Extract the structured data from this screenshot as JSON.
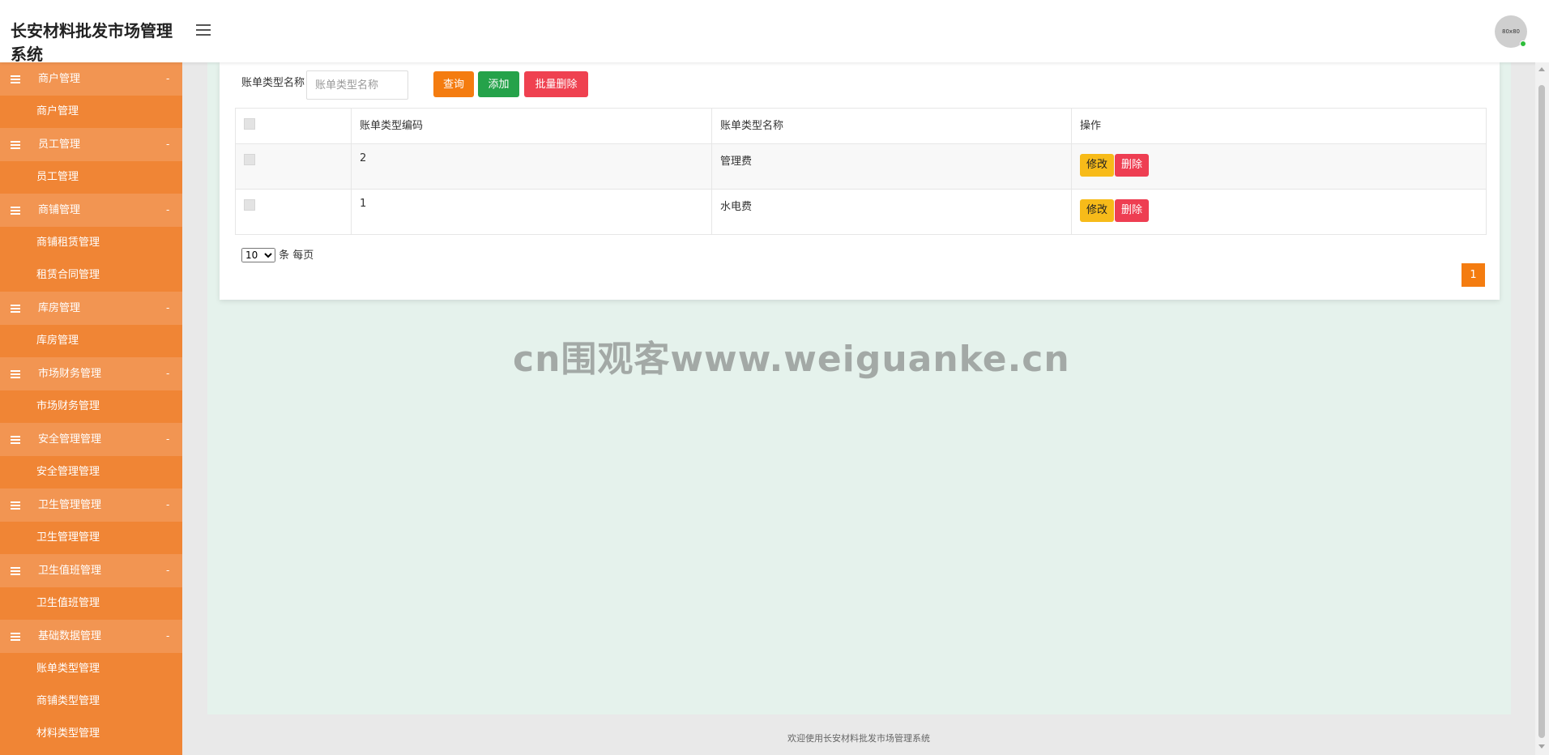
{
  "app": {
    "title": "长安材料批发市场管理系统",
    "avatar_text": "80x80"
  },
  "sidebar": {
    "groups": [
      {
        "label": "商户管理",
        "caret": "-",
        "items": [
          "商户管理"
        ]
      },
      {
        "label": "员工管理",
        "caret": "-",
        "items": [
          "员工管理"
        ]
      },
      {
        "label": "商铺管理",
        "caret": "-",
        "items": [
          "商铺租赁管理",
          "租赁合同管理"
        ]
      },
      {
        "label": "库房管理",
        "caret": "-",
        "items": [
          "库房管理"
        ]
      },
      {
        "label": "市场财务管理",
        "caret": "-",
        "items": [
          "市场财务管理"
        ]
      },
      {
        "label": "安全管理管理",
        "caret": "-",
        "items": [
          "安全管理管理"
        ]
      },
      {
        "label": "卫生管理管理",
        "caret": "-",
        "items": [
          "卫生管理管理"
        ]
      },
      {
        "label": "卫生值班管理",
        "caret": "-",
        "items": [
          "卫生值班管理"
        ]
      },
      {
        "label": "基础数据管理",
        "caret": "-",
        "items": [
          "账单类型管理",
          "商铺类型管理",
          "材料类型管理"
        ]
      }
    ]
  },
  "search": {
    "label": "账单类型名称",
    "placeholder": "账单类型名称",
    "value": ""
  },
  "toolbar": {
    "query_label": "查询",
    "add_label": "添加",
    "batch_delete_label": "批量删除"
  },
  "table": {
    "headers": {
      "code": "账单类型编码",
      "name": "账单类型名称",
      "actions": "操作"
    },
    "edit_label": "修改",
    "delete_label": "删除",
    "rows": [
      {
        "code": "2",
        "name": "管理费"
      },
      {
        "code": "1",
        "name": "水电费"
      }
    ]
  },
  "pagination": {
    "page_size_selected": "10",
    "page_size_options": [
      "10"
    ],
    "page_size_suffix": "条 每页",
    "current_page": "1"
  },
  "watermark": "cn围观客www.weiguanke.cn",
  "footer": "欢迎使用长安材料批发市场管理系统",
  "colors": {
    "sidebar": "#f08535",
    "sidebar_group": "#f29552",
    "content_bg": "#e5f2ec",
    "query": "#f47c10",
    "add": "#25a24a",
    "danger": "#ef4150",
    "edit": "#f7bb19"
  }
}
